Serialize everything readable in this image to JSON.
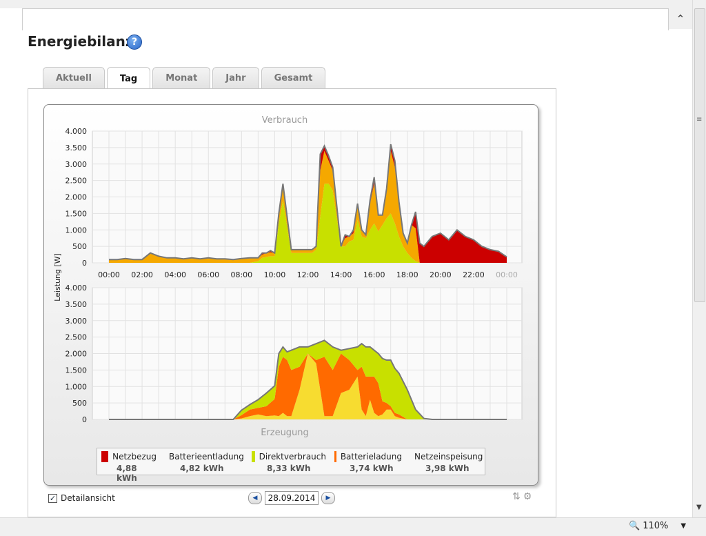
{
  "page": {
    "title": "Energiebilanz",
    "help_icon": "help-icon",
    "tabs": [
      {
        "label": "Aktuell",
        "active": false
      },
      {
        "label": "Tag",
        "active": true
      },
      {
        "label": "Monat",
        "active": false
      },
      {
        "label": "Jahr",
        "active": false
      },
      {
        "label": "Gesamt",
        "active": false
      }
    ]
  },
  "chart_data": [
    {
      "type": "area",
      "title": "Verbrauch",
      "ylabel": "Leistung [W]",
      "ylim": [
        0,
        4000
      ],
      "y_ticks": [
        "4.000",
        "3.500",
        "3.000",
        "2.500",
        "2.000",
        "1.500",
        "1.000",
        "500",
        "0"
      ],
      "x_ticks": [
        "00:00",
        "02:00",
        "04:00",
        "06:00",
        "08:00",
        "10:00",
        "12:00",
        "14:00",
        "16:00",
        "18:00",
        "20:00",
        "22:00",
        "00:00"
      ],
      "x_hours": [
        0,
        0.5,
        1,
        1.5,
        2,
        2.5,
        3,
        3.5,
        4,
        4.5,
        5,
        5.5,
        6,
        6.5,
        7,
        7.5,
        8,
        8.5,
        9,
        9.25,
        9.5,
        9.75,
        10,
        10.25,
        10.5,
        11,
        11.5,
        12,
        12.25,
        12.5,
        12.75,
        13,
        13.25,
        13.5,
        14,
        14.25,
        14.5,
        14.75,
        15,
        15.25,
        15.5,
        15.75,
        16,
        16.25,
        16.5,
        16.75,
        17,
        17.25,
        17.5,
        17.75,
        18,
        18.25,
        18.5,
        18.75,
        19,
        19.5,
        20,
        20.5,
        21,
        21.5,
        22,
        22.5,
        23,
        23.5,
        24
      ],
      "series": [
        {
          "name": "Direktverbrauch",
          "color": "#c8e000",
          "values": [
            0,
            0,
            0,
            0,
            0,
            0,
            0,
            0,
            0,
            0,
            0,
            0,
            0,
            0,
            0,
            0,
            0,
            0,
            50,
            150,
            180,
            200,
            200,
            1200,
            1900,
            300,
            300,
            300,
            300,
            400,
            1400,
            2400,
            2400,
            2200,
            500,
            500,
            650,
            700,
            1300,
            800,
            750,
            1000,
            1200,
            950,
            1150,
            1350,
            1500,
            1200,
            800,
            500,
            300,
            150,
            50,
            0,
            0,
            0,
            0,
            0,
            0,
            0,
            0,
            0,
            0,
            0,
            0
          ]
        },
        {
          "name": "Batterieentladung",
          "color": "#f5a800",
          "values": [
            100,
            100,
            130,
            100,
            100,
            300,
            200,
            150,
            150,
            120,
            150,
            120,
            150,
            120,
            120,
            100,
            130,
            150,
            100,
            100,
            120,
            120,
            100,
            300,
            400,
            100,
            100,
            100,
            100,
            100,
            1400,
            1000,
            700,
            600,
            0,
            250,
            150,
            200,
            500,
            200,
            100,
            800,
            1200,
            500,
            300,
            800,
            1900,
            1700,
            900,
            400,
            300,
            1000,
            1000,
            0,
            0,
            0,
            0,
            0,
            0,
            0,
            0,
            0,
            0,
            0,
            0
          ]
        },
        {
          "name": "Netzbezug",
          "color": "#cc0000",
          "values": [
            0,
            0,
            0,
            0,
            0,
            0,
            0,
            0,
            0,
            0,
            0,
            0,
            0,
            0,
            0,
            0,
            0,
            0,
            0,
            50,
            0,
            50,
            0,
            0,
            100,
            0,
            0,
            0,
            0,
            0,
            500,
            150,
            150,
            100,
            0,
            100,
            0,
            100,
            0,
            0,
            0,
            100,
            200,
            0,
            0,
            100,
            200,
            200,
            150,
            0,
            0,
            0,
            500,
            600,
            500,
            800,
            900,
            700,
            1000,
            800,
            700,
            500,
            400,
            350,
            180
          ]
        }
      ]
    },
    {
      "type": "area",
      "title": "Erzeugung",
      "ylabel": "Leistung [W]",
      "ylim": [
        0,
        4000
      ],
      "y_ticks": [
        "4.000",
        "3.500",
        "3.000",
        "2.500",
        "2.000",
        "1.500",
        "1.000",
        "500",
        "0"
      ],
      "x_hours": [
        0,
        7,
        7.5,
        8,
        8.5,
        9,
        9.5,
        10,
        10.25,
        10.5,
        10.75,
        11,
        11.5,
        12,
        12.5,
        13,
        13.5,
        14,
        14.5,
        15,
        15.25,
        15.5,
        15.75,
        16,
        16.25,
        16.5,
        16.75,
        17,
        17.25,
        17.5,
        18,
        18.5,
        19,
        19.5,
        20,
        24
      ],
      "series": [
        {
          "name": "Netzeinspeisung",
          "color": "#f7dc30",
          "values": [
            0,
            0,
            0,
            30,
            100,
            150,
            100,
            120,
            100,
            200,
            100,
            100,
            900,
            2000,
            1700,
            100,
            100,
            800,
            900,
            1300,
            300,
            100,
            600,
            200,
            100,
            150,
            300,
            300,
            100,
            50,
            0,
            0,
            0,
            0,
            0,
            0
          ]
        },
        {
          "name": "Batterieladung",
          "color": "#ff6a00",
          "values": [
            0,
            0,
            0,
            100,
            200,
            200,
            300,
            500,
            1500,
            1700,
            1700,
            1400,
            700,
            0,
            100,
            1800,
            1400,
            1200,
            900,
            200,
            1300,
            1200,
            700,
            1100,
            1000,
            400,
            200,
            100,
            100,
            100,
            0,
            0,
            0,
            0,
            0,
            0
          ]
        },
        {
          "name": "Direktverbrauch",
          "color": "#c8e000",
          "values": [
            0,
            0,
            0,
            150,
            150,
            250,
            400,
            400,
            400,
            300,
            250,
            600,
            600,
            200,
            500,
            500,
            700,
            100,
            350,
            700,
            700,
            900,
            900,
            800,
            900,
            1300,
            1300,
            1400,
            1350,
            1250,
            900,
            300,
            30,
            0,
            0,
            0
          ]
        }
      ]
    }
  ],
  "legend": [
    {
      "name": "Netzbezug",
      "value": "4,88 kWh",
      "color": "#cc0000"
    },
    {
      "name": "Batterieentladung",
      "value": "4,82 kWh",
      "color": "#f5a800"
    },
    {
      "name": "Direktverbrauch",
      "value": "8,33 kWh",
      "color": "#c8e000"
    },
    {
      "name": "Batterieladung",
      "value": "3,74 kWh",
      "color": "#ff6a00"
    },
    {
      "name": "Netzeinspeisung",
      "value": "3,98 kWh",
      "color": "#f7dc30"
    }
  ],
  "controls": {
    "detail_label": "Detailansicht",
    "detail_checked": true,
    "date": "28.09.2014"
  },
  "statusbar": {
    "zoom": "110%"
  }
}
